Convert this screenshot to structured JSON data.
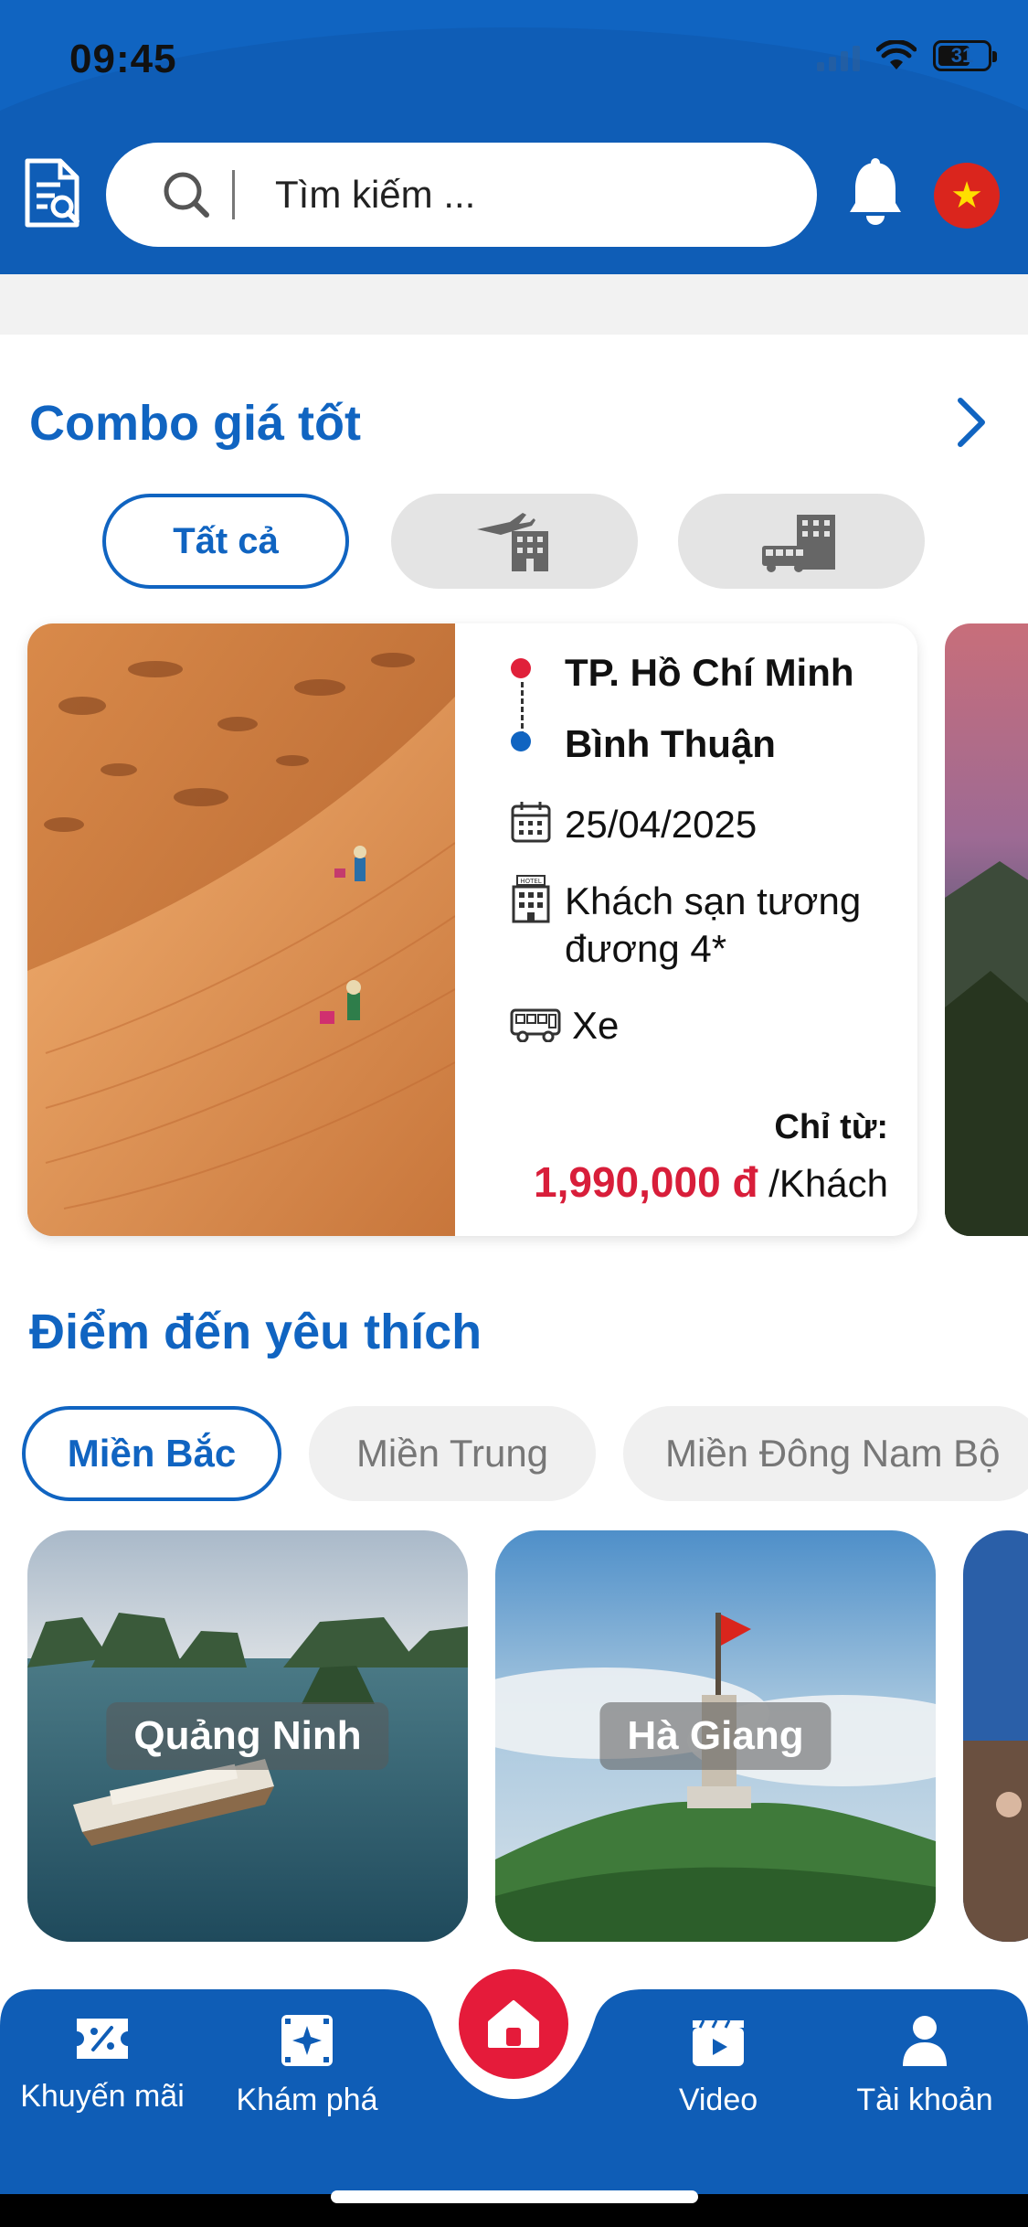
{
  "status_bar": {
    "time": "09:45",
    "battery": "31"
  },
  "search": {
    "placeholder": "Tìm kiếm ..."
  },
  "combo": {
    "title": "Combo giá tốt",
    "filters": [
      {
        "label": "Tất cả",
        "active": true
      },
      {
        "icon": "flight-hotel-icon",
        "active": false
      },
      {
        "icon": "bus-hotel-icon",
        "active": false
      }
    ],
    "card": {
      "from": "TP. Hồ Chí Minh",
      "to": "Bình Thuận",
      "date": "25/04/2025",
      "hotel": "Khách sạn tương đương 4*",
      "transport": "Xe",
      "price_label": "Chỉ từ:",
      "price": "1,990,000 đ",
      "price_unit": "/Khách"
    }
  },
  "destinations": {
    "title": "Điểm đến yêu thích",
    "tabs": [
      "Miền Bắc",
      "Miền Trung",
      "Miền Đông Nam Bộ"
    ],
    "cards": [
      "Quảng Ninh",
      "Hà Giang"
    ]
  },
  "bottom_nav": {
    "items": [
      "Khuyến mãi",
      "Khám phá",
      "Video",
      "Tài khoản"
    ]
  },
  "colors": {
    "primary": "#1064c1",
    "accent_red": "#e51b3a",
    "price_red": "#d81e3a"
  }
}
